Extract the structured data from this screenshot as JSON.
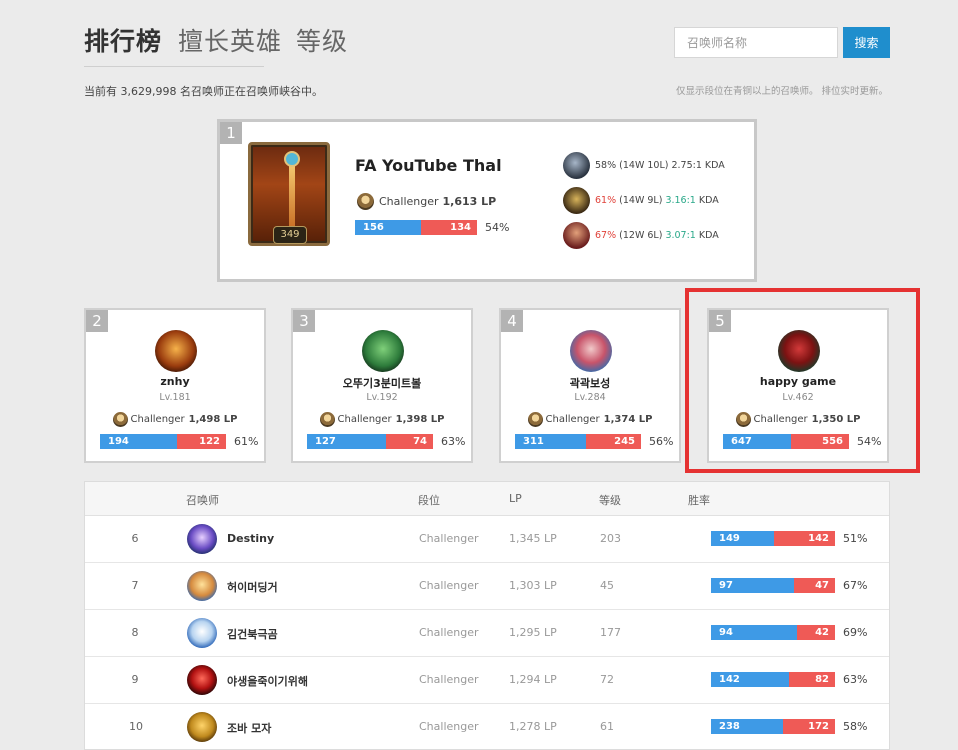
{
  "header": {
    "tabs": [
      {
        "label": "排行榜",
        "active": true
      },
      {
        "label": "擅长英雄",
        "active": false
      },
      {
        "label": "等级",
        "active": false
      }
    ],
    "search_placeholder": "召唤师名称",
    "search_button": "搜索",
    "summary": "当前有 3,629,998 名召唤师正在召唤师峡谷中。",
    "note": "仅显示段位在青铜以上的召唤师。 排位实时更新。"
  },
  "top": {
    "rank": "1",
    "name": "FA YouTube Thal",
    "level": "349",
    "tier": "Challenger",
    "lp": "1,613 LP",
    "wins": 156,
    "losses": 134,
    "win_rate": "54%",
    "win_fraction": 0.54,
    "champions": [
      {
        "rate": "58%",
        "record": "(14W 10L)",
        "kda": "2.75:1",
        "kda_label": "KDA",
        "rate_color": "#444444",
        "kda_color": "#444444"
      },
      {
        "rate": "61%",
        "record": "(14W 9L)",
        "kda": "3.16:1",
        "kda_label": "KDA",
        "rate_color": "#e0423a",
        "kda_color": "#2aa889"
      },
      {
        "rate": "67%",
        "record": "(12W 6L)",
        "kda": "3.07:1",
        "kda_label": "KDA",
        "rate_color": "#e0423a",
        "kda_color": "#2aa889"
      }
    ]
  },
  "cards": [
    {
      "rank": "2",
      "name": "znhy",
      "level": "Lv.181",
      "tier": "Challenger",
      "lp": "1,498 LP",
      "wins": 194,
      "losses": 122,
      "win_rate": "61%",
      "win_fraction": 0.61
    },
    {
      "rank": "3",
      "name": "오뚜기3분미트볼",
      "level": "Lv.192",
      "tier": "Challenger",
      "lp": "1,398 LP",
      "wins": 127,
      "losses": 74,
      "win_rate": "63%",
      "win_fraction": 0.63
    },
    {
      "rank": "4",
      "name": "곽곽보성",
      "level": "Lv.284",
      "tier": "Challenger",
      "lp": "1,374 LP",
      "wins": 311,
      "losses": 245,
      "win_rate": "56%",
      "win_fraction": 0.56
    },
    {
      "rank": "5",
      "name": "happy game",
      "level": "Lv.462",
      "tier": "Challenger",
      "lp": "1,350 LP",
      "wins": 647,
      "losses": 556,
      "win_rate": "54%",
      "win_fraction": 0.54
    }
  ],
  "table": {
    "headers": {
      "summoner": "召唤师",
      "tier": "段位",
      "lp": "LP",
      "level": "等级",
      "win_rate": "胜率"
    },
    "rows": [
      {
        "rank": "6",
        "name": "Destiny",
        "tier": "Challenger",
        "lp": "1,345 LP",
        "level": "203",
        "wins": 149,
        "losses": 142,
        "win_rate": "51%",
        "win_fraction": 0.51
      },
      {
        "rank": "7",
        "name": "허이머딩거",
        "tier": "Challenger",
        "lp": "1,303 LP",
        "level": "45",
        "wins": 97,
        "losses": 47,
        "win_rate": "67%",
        "win_fraction": 0.67
      },
      {
        "rank": "8",
        "name": "김건북극곰",
        "tier": "Challenger",
        "lp": "1,295 LP",
        "level": "177",
        "wins": 94,
        "losses": 42,
        "win_rate": "69%",
        "win_fraction": 0.69
      },
      {
        "rank": "9",
        "name": "야생을죽이기위해",
        "tier": "Challenger",
        "lp": "1,294 LP",
        "level": "72",
        "wins": 142,
        "losses": 82,
        "win_rate": "63%",
        "win_fraction": 0.63
      },
      {
        "rank": "10",
        "name": "조바 모자",
        "tier": "Challenger",
        "lp": "1,278 LP",
        "level": "61",
        "wins": 238,
        "losses": 172,
        "win_rate": "58%",
        "win_fraction": 0.58
      }
    ]
  },
  "colors": {
    "win": "#3e9ae6",
    "loss": "#ef5a56",
    "accent": "#1f8ecd",
    "highlight": "#e53232"
  }
}
